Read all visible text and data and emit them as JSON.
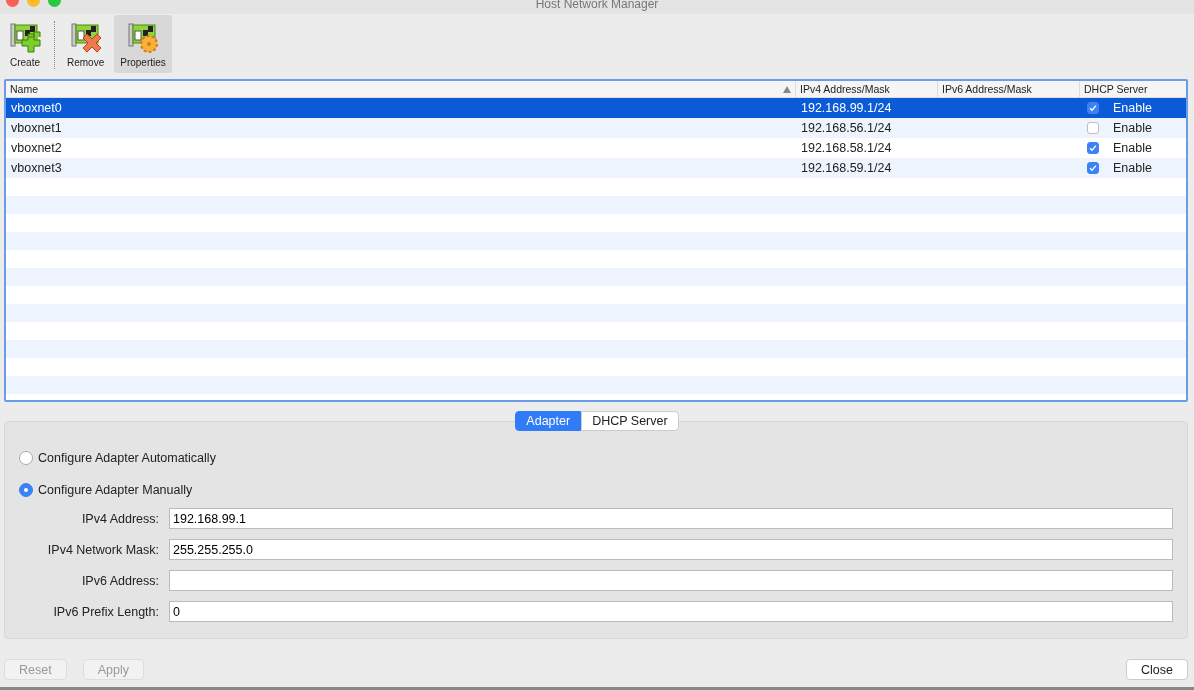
{
  "window": {
    "title": "Host Network Manager"
  },
  "toolbar": [
    {
      "label": "Create",
      "kind": "create",
      "selected": false
    },
    {
      "label": "Remove",
      "kind": "remove",
      "selected": false
    },
    {
      "label": "Properties",
      "kind": "properties",
      "selected": true
    }
  ],
  "table": {
    "columns": [
      "Name",
      "IPv4 Address/Mask",
      "IPv6 Address/Mask",
      "DHCP Server"
    ],
    "rows": [
      {
        "name": "vboxnet0",
        "ipv4": "192.168.99.1/24",
        "dhcp_label": "Enable",
        "dhcp_checked": true,
        "selected": true
      },
      {
        "name": "vboxnet1",
        "ipv4": "192.168.56.1/24",
        "dhcp_label": "Enable",
        "dhcp_checked": false,
        "selected": false
      },
      {
        "name": "vboxnet2",
        "ipv4": "192.168.58.1/24",
        "dhcp_label": "Enable",
        "dhcp_checked": true,
        "selected": false
      },
      {
        "name": "vboxnet3",
        "ipv4": "192.168.59.1/24",
        "dhcp_label": "Enable",
        "dhcp_checked": true,
        "selected": false
      }
    ]
  },
  "tabs": [
    {
      "label": "Adapter",
      "selected": true
    },
    {
      "label": "DHCP Server",
      "selected": false
    }
  ],
  "adapter": {
    "options": [
      {
        "label": "Configure Adapter Automatically",
        "selected": false
      },
      {
        "label": "Configure Adapter Manually",
        "selected": true
      }
    ],
    "fields": [
      {
        "label": "IPv4 Address:",
        "value": "192.168.99.1"
      },
      {
        "label": "IPv4 Network Mask:",
        "value": "255.255.255.0"
      },
      {
        "label": "IPv6 Address:"
      },
      {
        "label": "IPv6 Prefix Length:",
        "value": "0"
      }
    ]
  },
  "buttons": [
    {
      "label": "Reset",
      "disabled": true
    },
    {
      "label": "Apply",
      "disabled": true
    },
    {
      "label": "Close",
      "disabled": false
    }
  ]
}
